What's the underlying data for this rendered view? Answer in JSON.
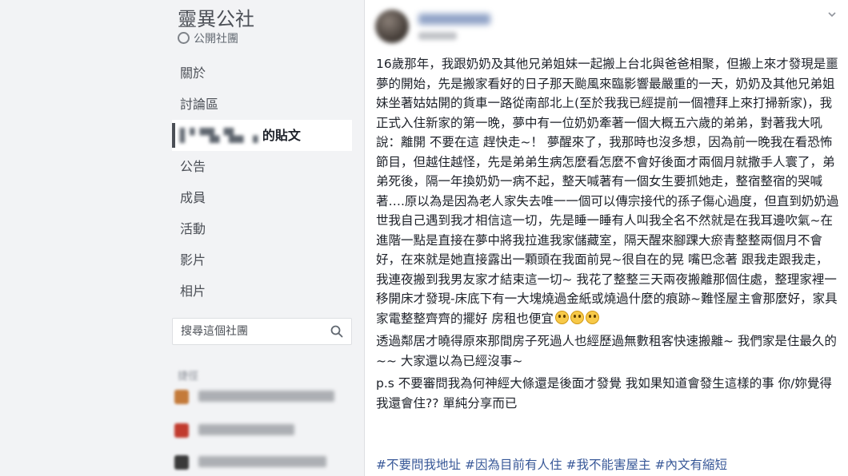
{
  "group": {
    "name": "靈異公社",
    "type": "公開社團"
  },
  "nav": {
    "items": [
      {
        "label": "關於",
        "name": "nav-about"
      },
      {
        "label": "討論區",
        "name": "nav-discussion"
      },
      {
        "label": "的貼文",
        "name": "nav-member-posts",
        "active": true,
        "blurred_prefix": "▌▘▀▙ ▜▄ ▗"
      },
      {
        "label": "公告",
        "name": "nav-announcements"
      },
      {
        "label": "成員",
        "name": "nav-members"
      },
      {
        "label": "活動",
        "name": "nav-events"
      },
      {
        "label": "影片",
        "name": "nav-videos"
      },
      {
        "label": "相片",
        "name": "nav-photos"
      }
    ]
  },
  "search": {
    "placeholder": "搜尋這個社團"
  },
  "sidebar": {
    "section_label": "捷徑"
  },
  "post": {
    "paragraphs": [
      "16歲那年，我跟奶奶及其他兄弟姐妹一起搬上台北與爸爸相聚，但搬上來才發現是噩夢的開始，先是搬家看好的日子那天颱風來臨影響最嚴重的一天，奶奶及其他兄弟姐妹坐著姑姑開的貨車一路從南部北上(至於我我已經提前一個禮拜上來打掃新家)，我正式入住新家的第一晚，夢中有一位奶奶牽著一個大概五六歲的弟弟，對著我大吼說：離開 不要在這 趕快走~！ 夢醒來了，我那時也沒多想，因為前一晚我在看恐怖節目，但越住越怪，先是弟弟生病怎麼看怎麼不會好後面才兩個月就撒手人寰了，弟弟死後，隔一年換奶奶一病不起，整天喊著有一個女生要抓她走，整宿整宿的哭喊著….原以為是因為老人家失去唯一一個可以傳宗接代的孫子傷心過度，但直到奶奶過世我自己遇到我才相信這一切，先是睡一睡有人叫我全名不然就是在我耳邊吹氣~在進階一點是直接在夢中將我拉進我家儲藏室，隔天醒來腳踝大瘀青整整兩個月不會好，在來就是她直接露出一顆頭在我面前晃~很自在的晃 嘴巴念著 跟我走跟我走，我連夜搬到我男友家才結束這一切~ 我花了整整三天兩夜搬離那個住處，整理家裡一移開床才發現-床底下有一大塊燒過金紙或燒過什麼的痕跡~難怪屋主會那麼好，家具家電整整齊齊的擺好 房租也便宜",
      "透過鄰居才曉得原來那間房子死過人也經歷過無數租客快速搬離~ 我們家是住最久的~~ 大家還以為已經沒事~",
      "p.s 不要審問我為何神經大條還是後面才發覺 我如果知道會發生這樣的事 你/妳覺得我還會住?? 單純分享而已"
    ],
    "emoji_count": 3,
    "hashtags": [
      "#不要問我地址",
      "#因為目前有人住",
      "#我不能害屋主",
      "#內文有縮短"
    ]
  },
  "colors": {
    "link": "#385898",
    "background": "#e9ebee",
    "card": "#ffffff",
    "sidebar": "#f2f3f5"
  },
  "icons": [
    "globe-icon",
    "search-icon",
    "chevron-down-icon",
    "emoji-icon"
  ]
}
